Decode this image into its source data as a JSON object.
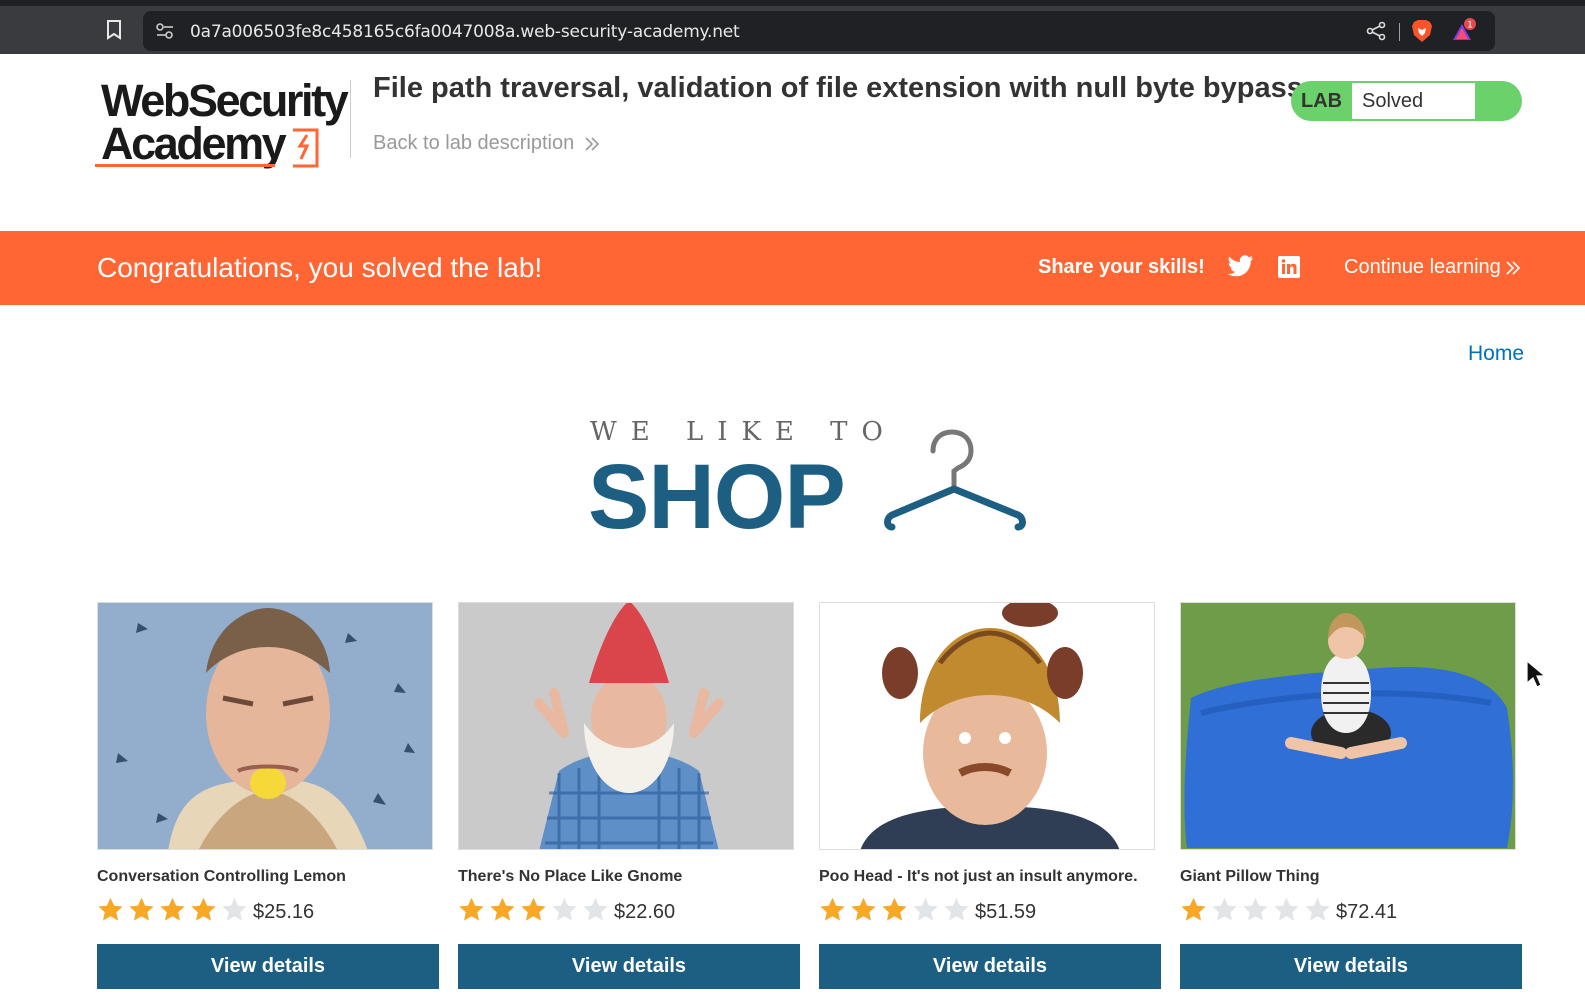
{
  "browser": {
    "url": "0a7a006503fe8c458165c6fa0047008a.web-security-academy.net",
    "icons": [
      "bookmark-icon",
      "site-settings-icon",
      "share-icon",
      "brave-shield-icon",
      "brave-rewards-icon"
    ],
    "rewards_badge": "1"
  },
  "lab_header": {
    "logo_line1": "WebSecurity",
    "logo_line2": "Academy",
    "title": "File path traversal, validation of file extension with null byte bypass",
    "back_link": "Back to lab description",
    "status_label": "LAB",
    "status_value": "Solved"
  },
  "banner": {
    "message": "Congratulations, you solved the lab!",
    "share_label": "Share your skills!",
    "continue_label": "Continue learning"
  },
  "shop": {
    "home_link": "Home",
    "tagline": "WE LIKE TO",
    "word": "SHOP"
  },
  "products": [
    {
      "name": "Conversation Controlling Lemon",
      "rating": 4,
      "price": "$25.16",
      "button": "View details"
    },
    {
      "name": "There's No Place Like Gnome",
      "rating": 3,
      "price": "$22.60",
      "button": "View details"
    },
    {
      "name": "Poo Head - It's not just an insult anymore.",
      "rating": 3,
      "price": "$51.59",
      "button": "View details"
    },
    {
      "name": "Giant Pillow Thing",
      "rating": 1,
      "price": "$72.41",
      "button": "View details"
    }
  ],
  "colors": {
    "banner": "#ff6633",
    "brand_blue": "#1c5f82",
    "solved_green": "#6bd16b",
    "star_filled": "#f9a825",
    "star_empty": "#e2e5e8"
  }
}
